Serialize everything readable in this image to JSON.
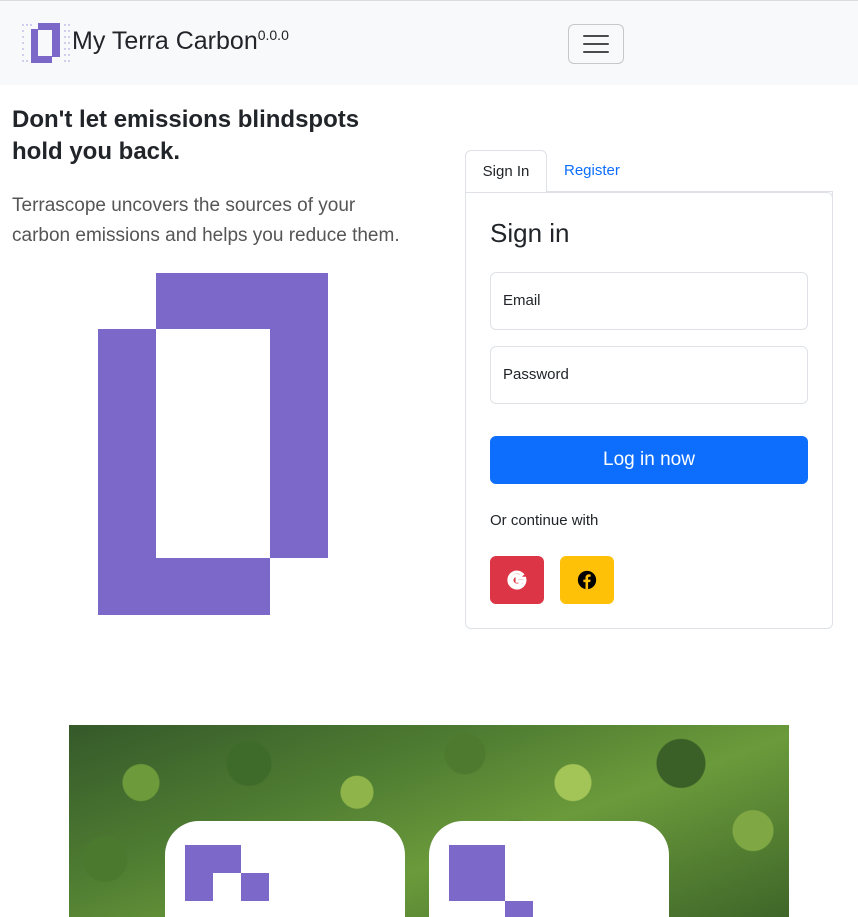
{
  "navbar": {
    "brand_name": "My Terra Carbon",
    "version": "0.0.0",
    "toggler_icon": "hamburger-menu-icon"
  },
  "hero": {
    "headline": "Don't let emissions blindspots hold you back.",
    "lead": "Terrascope uncovers the sources of your carbon emissions and helps you reduce them."
  },
  "auth": {
    "tabs": [
      {
        "label": "Sign In",
        "active": true
      },
      {
        "label": "Register",
        "active": false
      }
    ],
    "title": "Sign in",
    "email_label": "Email",
    "password_label": "Password",
    "login_label": "Log in now",
    "continue_label": "Or continue with",
    "social": [
      {
        "name": "google",
        "icon": "google-icon",
        "color": "#dc3545"
      },
      {
        "name": "facebook",
        "icon": "facebook-icon",
        "color": "#ffc107"
      }
    ]
  },
  "colors": {
    "brand_purple": "#7b68c8",
    "primary": "#0d6efd"
  }
}
